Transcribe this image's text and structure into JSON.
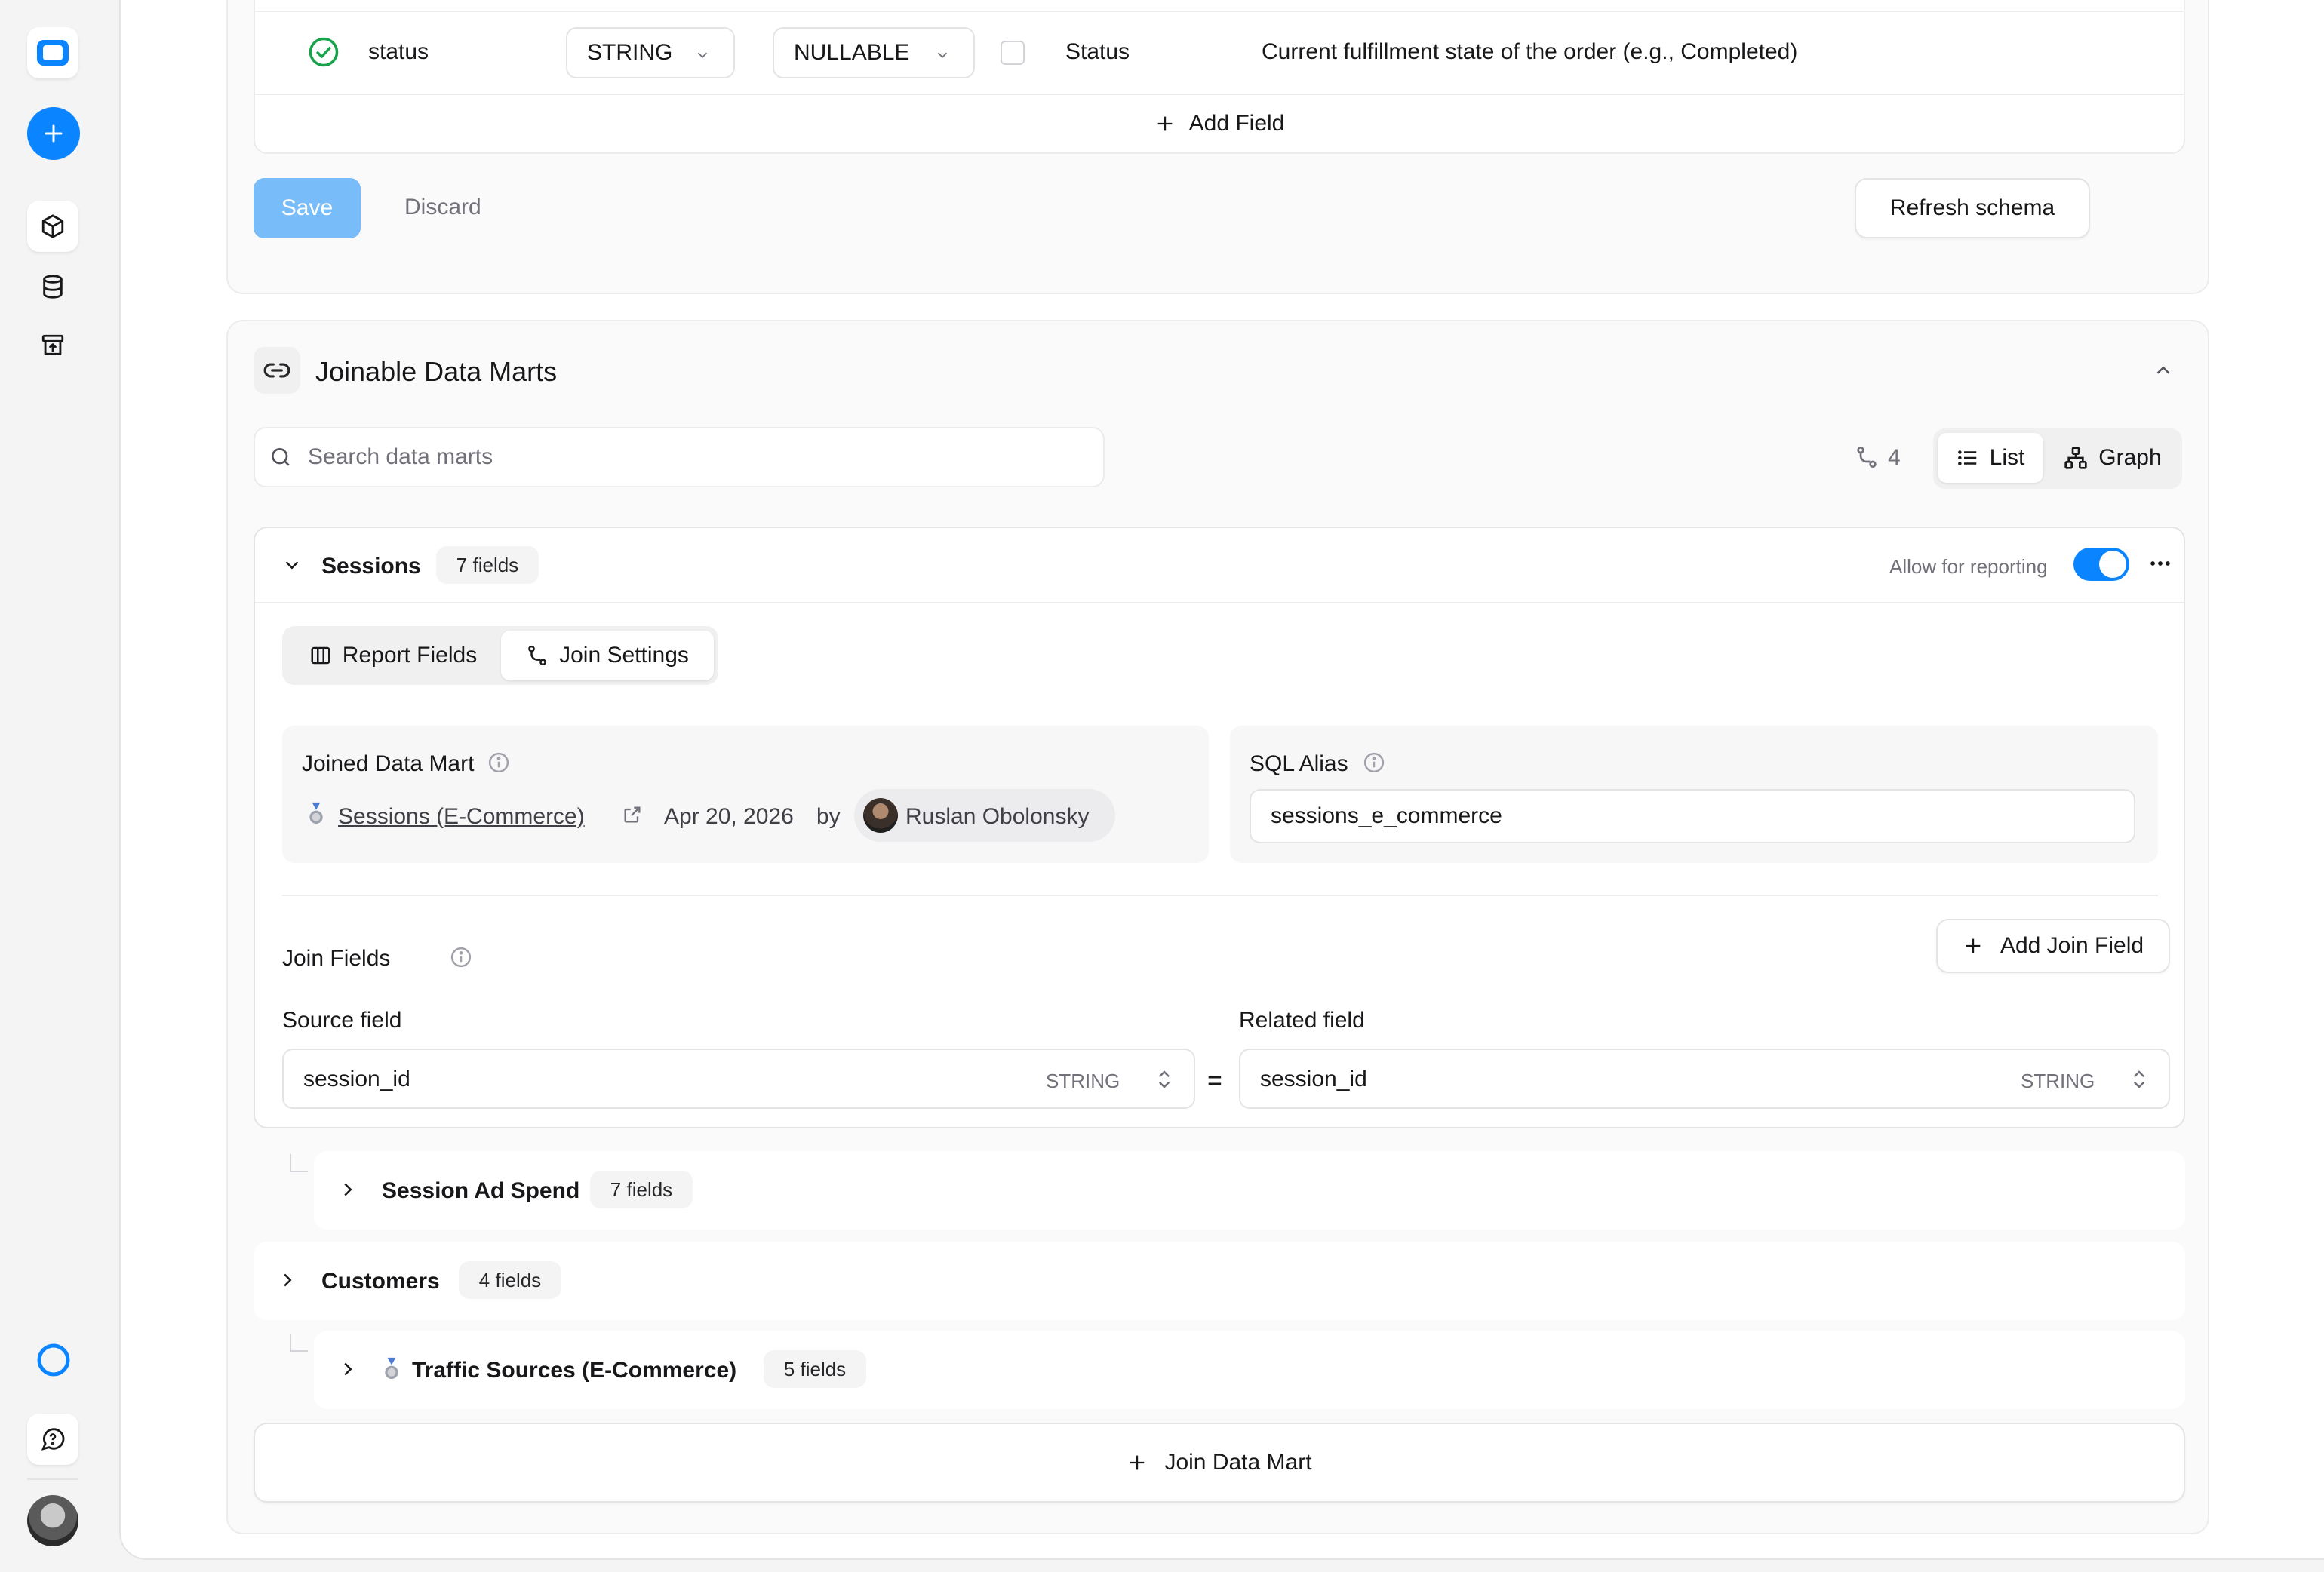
{
  "colors": {
    "accent": "#0a84ff",
    "save_disabled": "#78bdf9",
    "success": "#16a34a"
  },
  "rail": {
    "icons": [
      "app-logo-icon",
      "new-plus-icon",
      "data-marts-cube-icon",
      "storage-database-icon",
      "destinations-archive-icon",
      "status-ring-icon",
      "help-chat-icon",
      "user-avatar"
    ]
  },
  "schema_row": {
    "name": "status",
    "type": "STRING",
    "mode": "NULLABLE",
    "alias": "Status",
    "description": "Current fulfillment state of the order (e.g., Completed)"
  },
  "schema_actions": {
    "add_field": "Add Field",
    "save": "Save",
    "discard": "Discard",
    "refresh": "Refresh schema"
  },
  "joinable": {
    "title": "Joinable Data Marts",
    "search_placeholder": "Search data marts",
    "join_count": "4",
    "view_list": "List",
    "view_graph": "Graph",
    "join_data_mart": "Join Data Mart"
  },
  "sessions": {
    "name": "Sessions",
    "fields_badge": "7 fields",
    "allow_reporting_label": "Allow for reporting",
    "allow_reporting": true,
    "tabs": [
      "Report Fields",
      "Join Settings"
    ],
    "active_tab": "Join Settings",
    "joined_data_mart_label": "Joined Data Mart",
    "joined_data_mart_name": "Sessions (E-Commerce)",
    "joined_date": "Apr 20, 2026",
    "joined_by": "by",
    "joined_user": "Ruslan Obolonsky",
    "sql_alias_label": "SQL Alias",
    "sql_alias_value": "sessions_e_commerce",
    "join_fields_label": "Join Fields",
    "add_join_field": "Add Join Field",
    "source_field_label": "Source field",
    "related_field_label": "Related field",
    "source_field_value": "session_id",
    "source_field_type": "STRING",
    "equals": "=",
    "related_field_value": "session_id",
    "related_field_type": "STRING"
  },
  "other_marts": [
    {
      "name": "Session Ad Spend",
      "fields_badge": "7 fields",
      "nested": true
    },
    {
      "name": "Customers",
      "fields_badge": "4 fields",
      "nested": false
    },
    {
      "name": "Traffic Sources (E-Commerce)",
      "fields_badge": "5 fields",
      "nested": true
    }
  ]
}
